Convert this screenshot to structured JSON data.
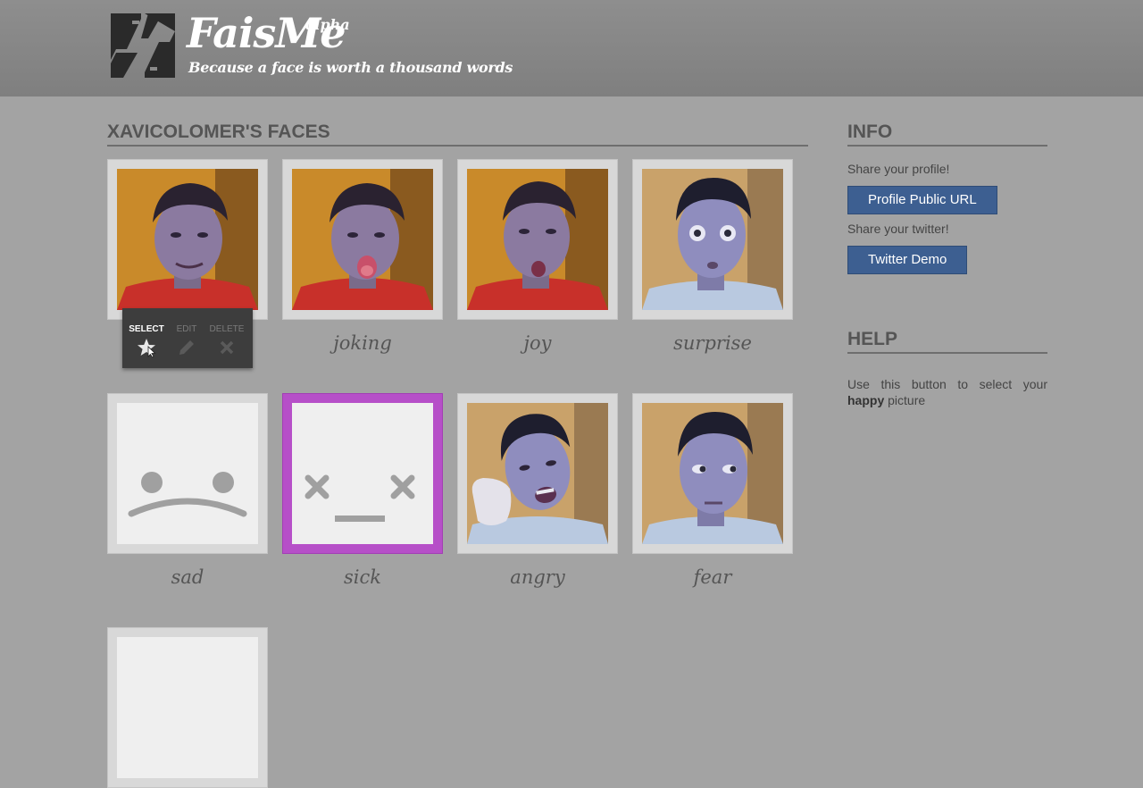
{
  "header": {
    "logo_icon": "faisme-logo-icon",
    "brand": "FaisMe",
    "brand_sup": "alpha",
    "tagline": "Because a face is worth a thousand words"
  },
  "faces_section": {
    "title": "XAVICOLOMER'S FACES",
    "faces": [
      {
        "label": "",
        "kind": "photo",
        "shirt": "#c8302a",
        "bg": "#c98a2a"
      },
      {
        "label": "joking",
        "kind": "photo",
        "shirt": "#c8302a",
        "bg": "#c98a2a"
      },
      {
        "label": "joy",
        "kind": "photo",
        "shirt": "#c8302a",
        "bg": "#c98a2a"
      },
      {
        "label": "surprise",
        "kind": "photo",
        "shirt": "#b9c9e0",
        "bg": "#c9a26a"
      },
      {
        "label": "sad",
        "kind": "placeholder-sad"
      },
      {
        "label": "sick",
        "kind": "placeholder-sick",
        "highlight_color": "#b64fc8"
      },
      {
        "label": "angry",
        "kind": "photo",
        "shirt": "#b9c9e0",
        "bg": "#c9a26a"
      },
      {
        "label": "fear",
        "kind": "photo",
        "shirt": "#b9c9e0",
        "bg": "#c9a26a"
      },
      {
        "label": "",
        "kind": "placeholder-partial"
      }
    ],
    "toolbar": {
      "select_label": "SELECT",
      "edit_label": "EDIT",
      "delete_label": "DELETE",
      "select_icon": "star-icon",
      "edit_icon": "pencil-icon",
      "delete_icon": "x-icon"
    }
  },
  "info": {
    "title": "INFO",
    "share_profile": "Share your profile!",
    "profile_button": "Profile Public URL",
    "share_twitter": "Share your twitter!",
    "twitter_button": "Twitter Demo",
    "button_color": "#3d5f91"
  },
  "help": {
    "title": "HELP",
    "text_before": "Use this button to select your",
    "text_bold": "happy",
    "text_after": "picture"
  }
}
